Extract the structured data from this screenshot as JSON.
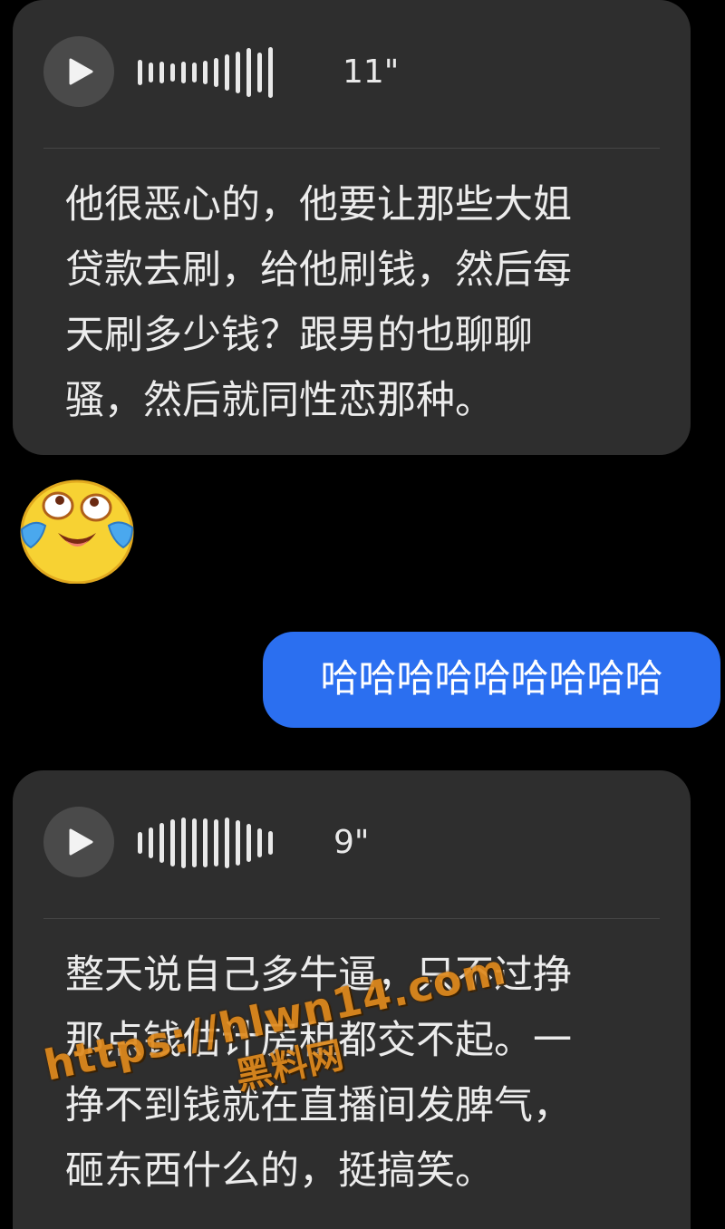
{
  "messages": [
    {
      "type": "voice",
      "duration": "11\"",
      "transcript": "他很恶心的，他要让那些大姐\n贷款去刷，给他刷钱，然后每\n天刷多少钱？跟男的也聊聊\n骚，然后就同性恋那种。"
    },
    {
      "type": "sticker",
      "icon": "crying-laughing-face-icon"
    },
    {
      "type": "text-outgoing",
      "text": "哈哈哈哈哈哈哈哈哈"
    },
    {
      "type": "voice",
      "duration": "9\"",
      "transcript": "整天说自己多牛逼，只不过挣\n那点钱估计房租都交不起。一\n挣不到钱就在直播间发脾气，\n砸东西什么的，挺搞笑。"
    }
  ],
  "watermark": {
    "url": "https://hlwn14.com",
    "name": "黑料网"
  },
  "colors": {
    "background": "#000000",
    "incoming_bubble": "#2e2e2e",
    "outgoing_bubble": "#2b6ff0",
    "watermark": "#e08a1c"
  }
}
